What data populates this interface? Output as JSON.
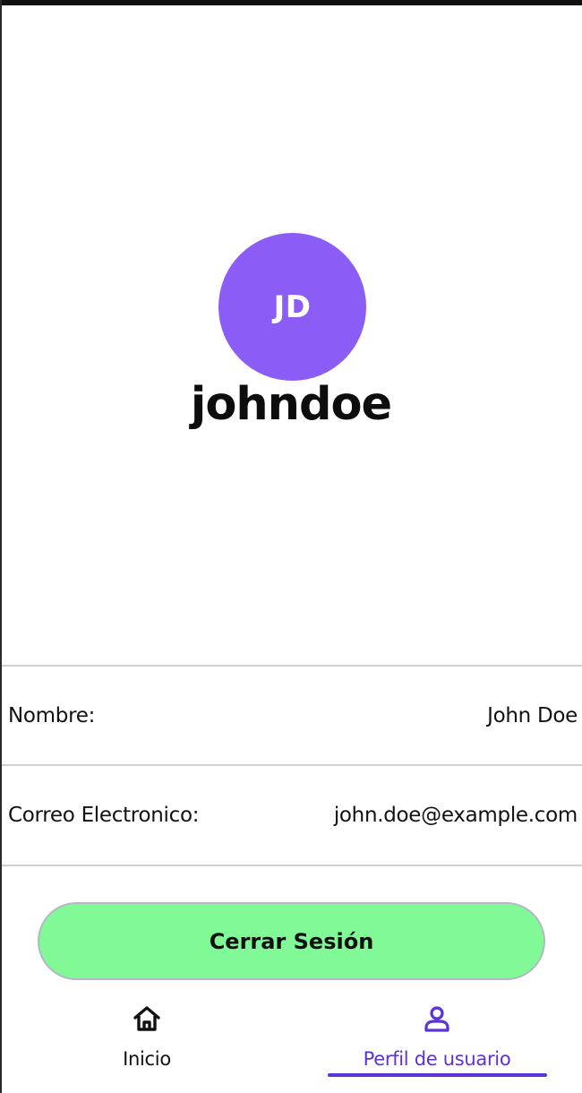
{
  "profile": {
    "initials": "JD",
    "username": "johndoe"
  },
  "info": {
    "rows": [
      {
        "label": "Nombre:",
        "value": "John Doe"
      },
      {
        "label": "Correo Electronico:",
        "value": "john.doe@example.com"
      }
    ]
  },
  "actions": {
    "logout_label": "Cerrar Sesión"
  },
  "nav": {
    "items": [
      {
        "label": "Inicio",
        "icon": "home-icon",
        "active": false
      },
      {
        "label": "Perfil de usuario",
        "icon": "user-icon",
        "active": true
      }
    ]
  },
  "colors": {
    "avatar": "#8b5cf6",
    "logout_button": "#80f996",
    "active_nav": "#5b33d6",
    "inactive_nav": "#111111"
  }
}
